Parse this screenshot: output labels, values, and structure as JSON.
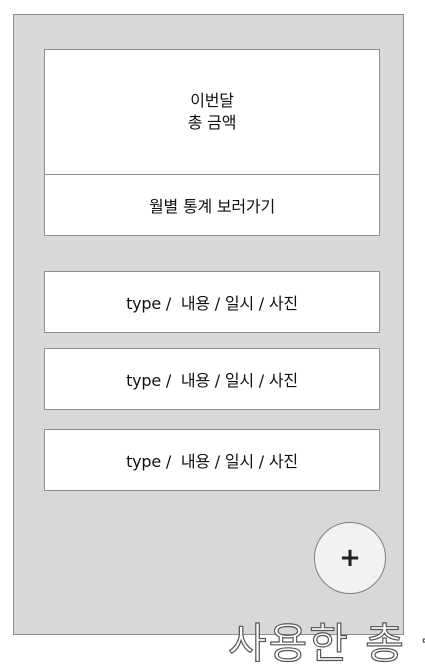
{
  "summary": {
    "month_label": "이번달",
    "total_label": "총 금액",
    "stats_link": "월별 통계 보러가기"
  },
  "records": [
    {
      "text": "type /  내용 / 일시 / 사진"
    },
    {
      "text": "type /  내용 / 일시 / 사진"
    },
    {
      "text": "type /  내용 / 일시 / 사진"
    }
  ],
  "fab": {
    "label": "+"
  },
  "caption": {
    "text": "사용한 총 금"
  }
}
